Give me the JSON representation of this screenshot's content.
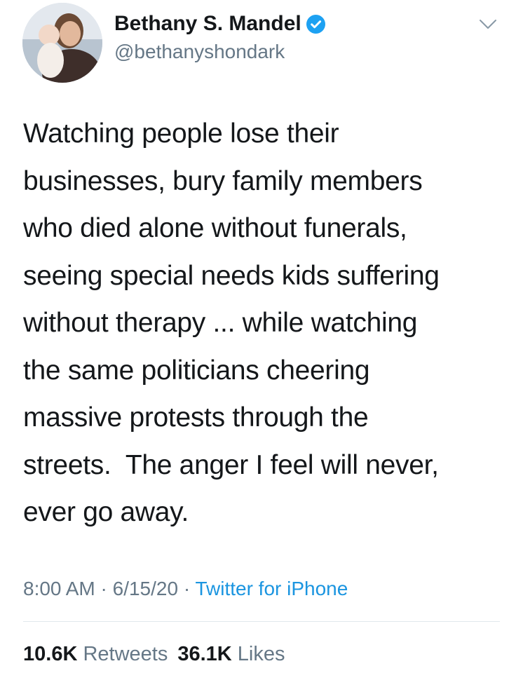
{
  "tweet": {
    "author": {
      "display_name": "Bethany S. Mandel",
      "handle": "@bethanyshondark",
      "verified": true
    },
    "text": "Watching people lose their\nbusinesses, bury family members\nwho died alone without funerals,\nseeing special needs kids suffering\nwithout therapy ... while watching\nthe same politicians cheering\nmassive protests through the\nstreets.  The anger I feel will never,\never go away.",
    "time": "8:00 AM",
    "date": "6/15/20",
    "separator": "·",
    "source": "Twitter for iPhone",
    "stats": {
      "retweets_count": "10.6K",
      "retweets_label": "Retweets",
      "likes_count": "36.1K",
      "likes_label": "Likes"
    }
  },
  "icons": {
    "verified": "verified-badge-icon",
    "menu": "chevron-down-icon"
  },
  "colors": {
    "text": "#14171a",
    "secondary": "#657786",
    "link": "#1b95e0",
    "verified": "#1da1f2",
    "divider": "#e1e8ed"
  }
}
